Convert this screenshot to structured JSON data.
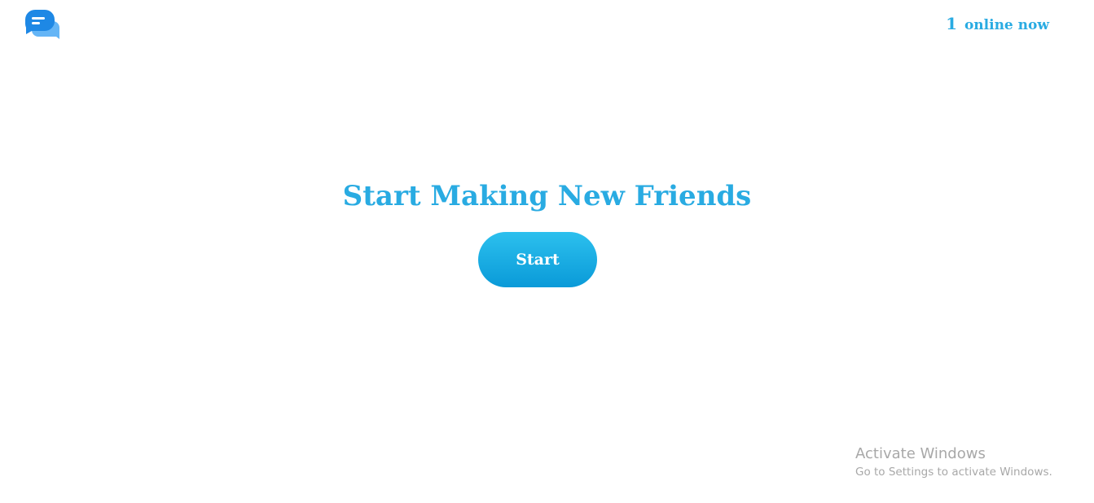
{
  "header": {
    "logo_icon": "chat-bubbles-icon",
    "online_count": "1",
    "online_label": "online now"
  },
  "hero": {
    "title": "Start Making New Friends",
    "start_label": "Start"
  },
  "watermark": {
    "title": "Activate Windows",
    "subtitle": "Go to Settings to activate Windows."
  },
  "colors": {
    "accent": "#29abe2",
    "button_top": "#2cc0ee",
    "button_bottom": "#0a9ad8",
    "logo_front": "#1e88e5",
    "logo_back": "#64b5f6"
  }
}
